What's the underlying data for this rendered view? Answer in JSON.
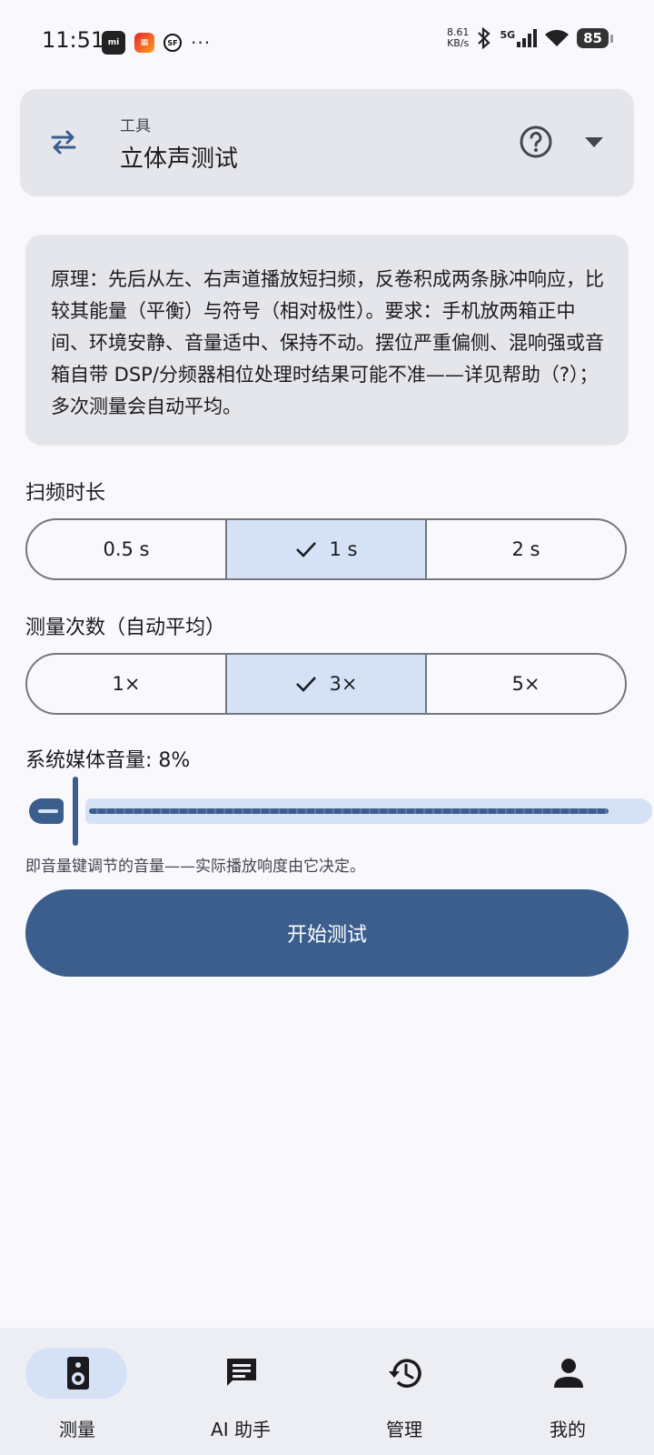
{
  "status_bar": {
    "time": "11:51",
    "app_icons": [
      "mi-icon",
      "game-icon",
      "sf-icon"
    ],
    "more": "···",
    "net_speed_value": "8.61",
    "net_speed_unit": "KB/s",
    "network": "5G",
    "battery": "85"
  },
  "tool_selector": {
    "label": "工具",
    "title": "立体声测试"
  },
  "info": {
    "text": "原理：先后从左、右声道播放短扫频，反卷积成两条脉冲响应，比较其能量（平衡）与符号（相对极性）。要求：手机放两箱正中间、环境安静、音量适中、保持不动。摆位严重偏侧、混响强或音箱自带 DSP/分频器相位处理时结果可能不准——详见帮助（?）；多次测量会自动平均。"
  },
  "sweep_duration": {
    "label": "扫频时长",
    "options": [
      "0.5 s",
      "1 s",
      "2 s"
    ],
    "selected_index": 1
  },
  "measure_count": {
    "label": "测量次数（自动平均）",
    "options": [
      "1×",
      "3×",
      "5×"
    ],
    "selected_index": 1
  },
  "volume": {
    "label": "系统媒体音量: 8%",
    "value_percent": 8,
    "hint": "即音量键调节的音量——实际播放响度由它决定。"
  },
  "start_button": {
    "label": "开始测试"
  },
  "bottom_nav": {
    "items": [
      {
        "label": "测量",
        "icon": "speaker-icon",
        "selected": true
      },
      {
        "label": "AI 助手",
        "icon": "chat-icon",
        "selected": false
      },
      {
        "label": "管理",
        "icon": "history-icon",
        "selected": false
      },
      {
        "label": "我的",
        "icon": "person-icon",
        "selected": false
      }
    ]
  },
  "colors": {
    "primary": "#3b5e8d",
    "selected_bg": "#d5e1f5",
    "card_bg": "#e5e6ec",
    "page_bg": "#f8f8fd"
  }
}
